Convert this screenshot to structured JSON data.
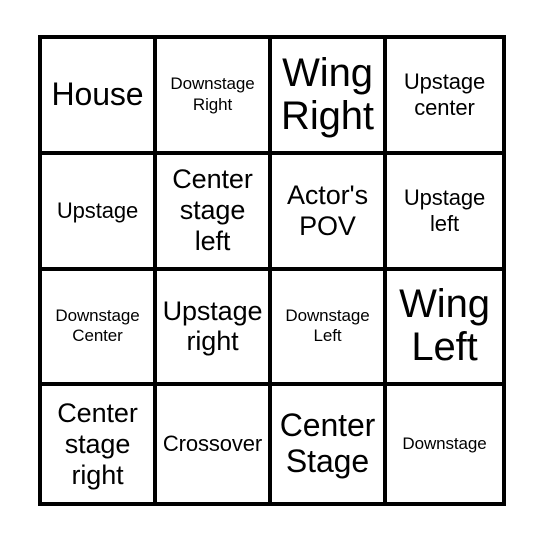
{
  "card": {
    "type": "bingo-card",
    "columns": 4,
    "rows": 4,
    "border_color": "#000000",
    "background_color": "#ffffff",
    "text_color": "#000000",
    "cells": [
      {
        "label": "House",
        "size": "lg"
      },
      {
        "label": "Downstage Right",
        "size": "xs"
      },
      {
        "label": "Wing Right",
        "size": "xl"
      },
      {
        "label": "Upstage center",
        "size": "sm"
      },
      {
        "label": "Upstage",
        "size": "sm"
      },
      {
        "label": "Center stage left",
        "size": "md"
      },
      {
        "label": "Actor's POV",
        "size": "md"
      },
      {
        "label": "Upstage left",
        "size": "sm"
      },
      {
        "label": "Downstage Center",
        "size": "xs"
      },
      {
        "label": "Upstage right",
        "size": "md"
      },
      {
        "label": "Downstage Left",
        "size": "xs"
      },
      {
        "label": "Wing Left",
        "size": "xl"
      },
      {
        "label": "Center stage right",
        "size": "md"
      },
      {
        "label": "Crossover",
        "size": "sm"
      },
      {
        "label": "Center Stage",
        "size": "lg"
      },
      {
        "label": "Downstage",
        "size": "xs"
      }
    ]
  }
}
